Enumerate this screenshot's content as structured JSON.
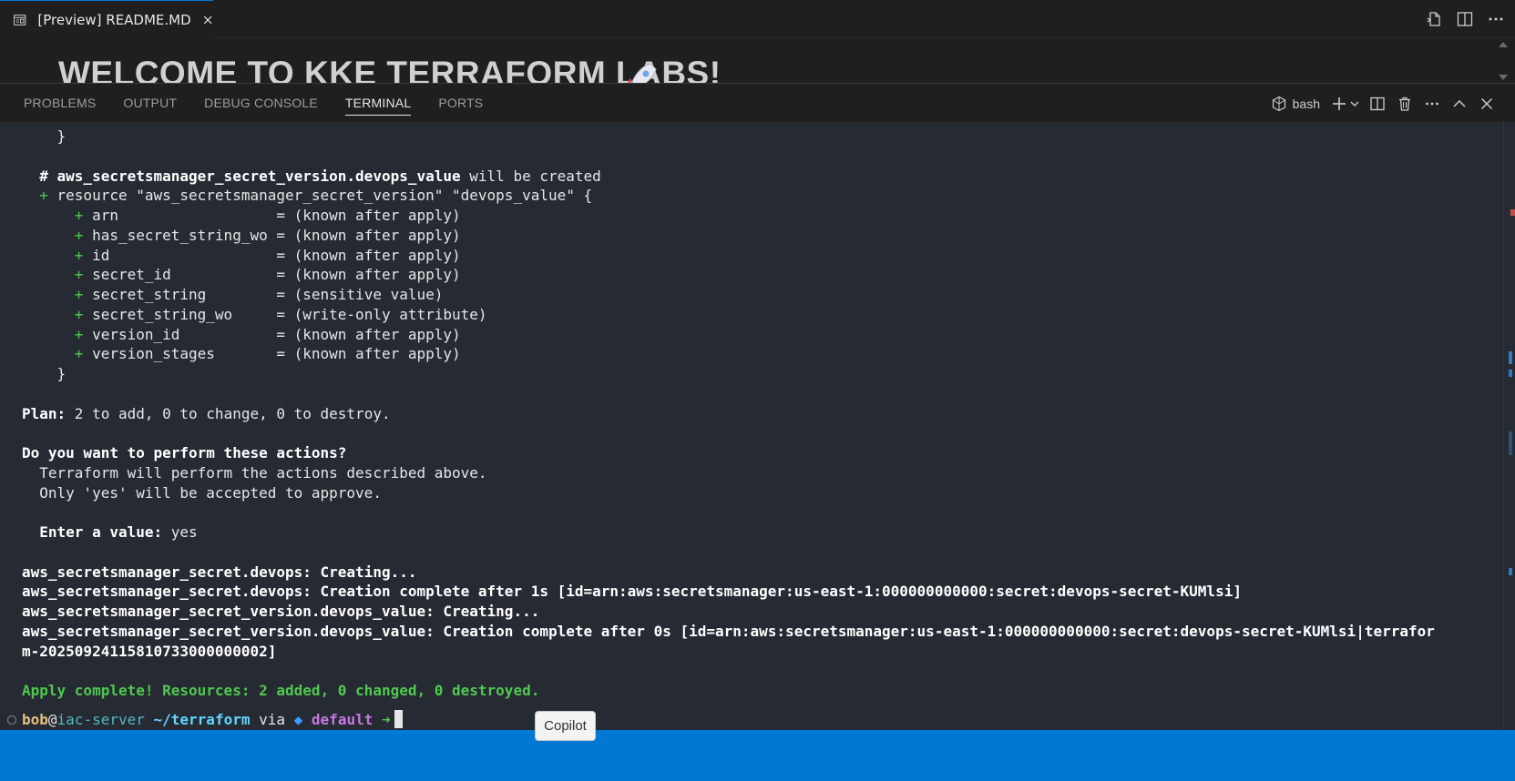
{
  "editor": {
    "tab_label": "[Preview] README.MD",
    "heading": "WELCOME TO KKE TERRAFORM LABS!"
  },
  "panel": {
    "tabs": [
      "PROBLEMS",
      "OUTPUT",
      "DEBUG CONSOLE",
      "TERMINAL",
      "PORTS"
    ],
    "active_tab": "TERMINAL",
    "shell_label": "bash"
  },
  "terminal": {
    "lines": {
      "l01": "    }",
      "l02": "",
      "l03_hash": "  # ",
      "l03_res": "aws_secretsmanager_secret_version.devops_value",
      "l03_rest": " will be created",
      "l04_plus": "  + ",
      "l04_rest": "resource \"aws_secretsmanager_secret_version\" \"devops_value\" {",
      "attrs": [
        {
          "name": "arn                 ",
          "value": "= (known after apply)"
        },
        {
          "name": "has_secret_string_wo",
          "value": "= (known after apply)"
        },
        {
          "name": "id                  ",
          "value": "= (known after apply)"
        },
        {
          "name": "secret_id           ",
          "value": "= (known after apply)"
        },
        {
          "name": "secret_string       ",
          "value": "= (sensitive value)"
        },
        {
          "name": "secret_string_wo    ",
          "value": "= (write-only attribute)"
        },
        {
          "name": "version_id          ",
          "value": "= (known after apply)"
        },
        {
          "name": "version_stages      ",
          "value": "= (known after apply)"
        }
      ],
      "l13": "    }",
      "plan_label": "Plan:",
      "plan_rest": " 2 to add, 0 to change, 0 to destroy.",
      "question": "Do you want to perform these actions?",
      "desc1": "  Terraform will perform the actions described above.",
      "desc2": "  Only 'yes' will be accepted to approve.",
      "enter_label": "  Enter a value:",
      "enter_value": " yes",
      "c1": "aws_secretsmanager_secret.devops: Creating...",
      "c2": "aws_secretsmanager_secret.devops: Creation complete after 1s [id=arn:aws:secretsmanager:us-east-1:000000000000:secret:devops-secret-KUMlsi]",
      "c3": "aws_secretsmanager_secret_version.devops_value: Creating...",
      "c4": "aws_secretsmanager_secret_version.devops_value: Creation complete after 0s [id=arn:aws:secretsmanager:us-east-1:000000000000:secret:devops-secret-KUMlsi|terrafor",
      "c5": "m-20250924115810733000000002]",
      "apply": "Apply complete! Resources: 2 added, 0 changed, 0 destroyed."
    },
    "prompt": {
      "user": "bob",
      "at": "@",
      "host": "iac-server",
      "path": " ~/terraform",
      "via": " via ",
      "workspace": " default",
      "arrow": " ➜"
    }
  },
  "tooltip": "Copilot",
  "colors": {
    "accent": "#0078d4",
    "terminal_bg": "#262a33",
    "green": "#4ec94e"
  }
}
